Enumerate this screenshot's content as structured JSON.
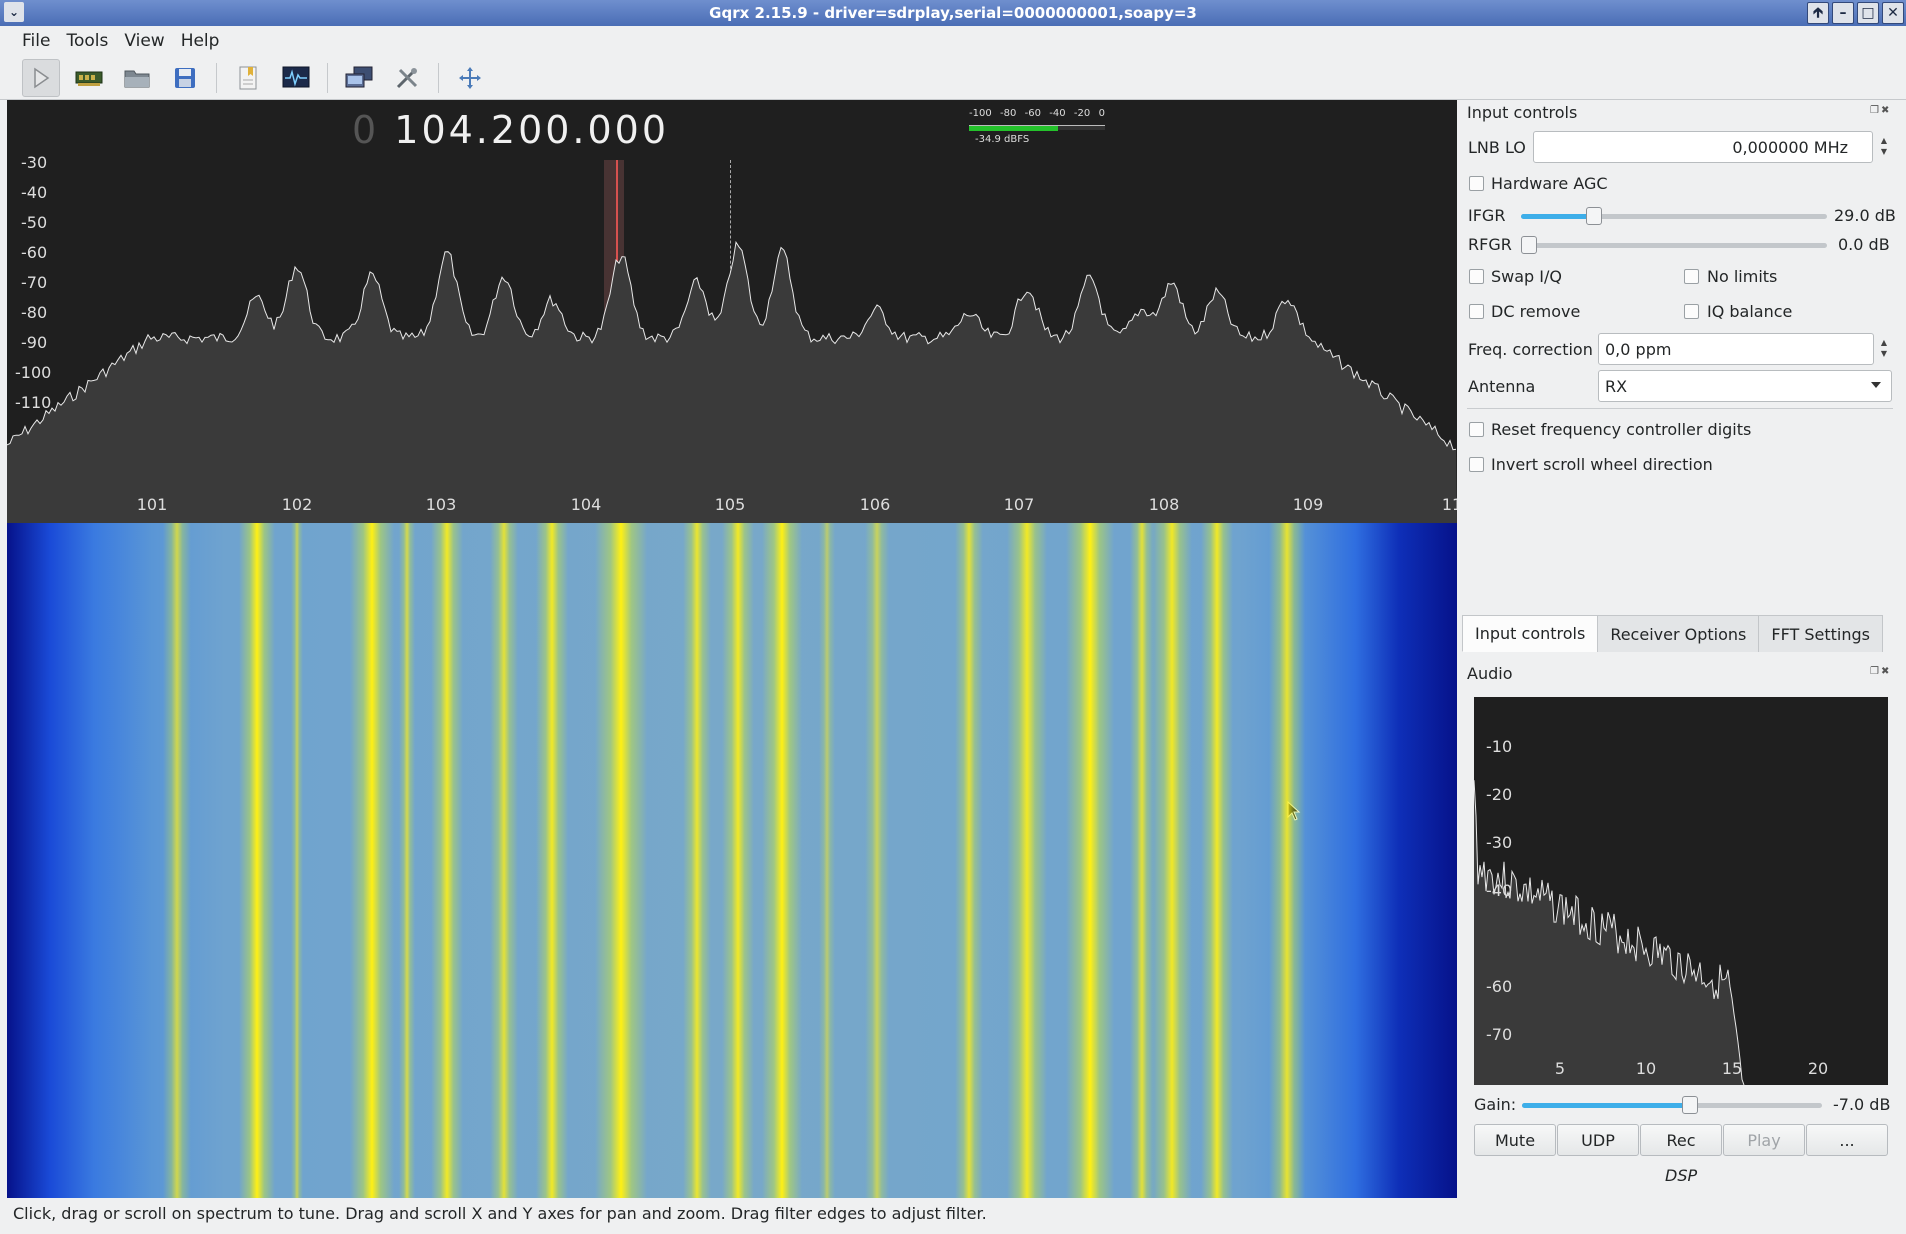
{
  "window": {
    "title": "Gqrx 2.15.9 - driver=sdrplay,serial=0000000001,soapy=3",
    "menu_icon": "chevron-down-icon",
    "buttons": [
      "pin-icon",
      "minimize-icon",
      "maximize-icon",
      "close-icon"
    ]
  },
  "menubar": {
    "items": [
      {
        "label": "File",
        "mnemonic": "F"
      },
      {
        "label": "Tools",
        "mnemonic": "T"
      },
      {
        "label": "View",
        "mnemonic": "V"
      },
      {
        "label": "Help",
        "mnemonic": "H"
      }
    ]
  },
  "toolbar": {
    "items": [
      "play-icon",
      "hardware-icon",
      "open-folder-icon",
      "save-icon",
      "bookmark-icon",
      "io-config-icon",
      "remote-control-icon",
      "tools-icon",
      "fullscreen-icon"
    ]
  },
  "spectrum": {
    "freq_prefix": "0",
    "freq": "104.200.000",
    "smeter_ticks": [
      "-100",
      "-80",
      "-60",
      "-40",
      "-20",
      "0"
    ],
    "smeter_level_dbfs": -34.9,
    "smeter_text": "-34.9 dBFS",
    "db_ticks": [
      "-30",
      "-40",
      "-50",
      "-60",
      "-70",
      "-80",
      "-90",
      "-100",
      "-110"
    ],
    "freq_ticks": [
      "101",
      "102",
      "103",
      "104",
      "105",
      "106",
      "107",
      "108",
      "109",
      "11"
    ]
  },
  "input_controls": {
    "title": "Input controls",
    "lnb_lo_label": "LNB LO",
    "lnb_lo_value": "0,000000 MHz",
    "hardware_agc": "Hardware AGC",
    "ifgr_label": "IFGR",
    "ifgr_value": "29.0 dB",
    "ifgr_level": 0.24,
    "rfgr_label": "RFGR",
    "rfgr_value": "0.0 dB",
    "rfgr_level": 0.0,
    "swap_iq": "Swap I/Q",
    "no_limits": "No limits",
    "dc_remove": "DC remove",
    "iq_balance": "IQ balance",
    "freq_corr_label": "Freq. correction",
    "freq_corr_value": "0,0 ppm",
    "antenna_label": "Antenna",
    "antenna_value": "RX",
    "reset_freq": "Reset frequency controller digits",
    "invert_scroll": "Invert scroll wheel direction"
  },
  "tabs": [
    "Input controls",
    "Receiver Options",
    "FFT Settings"
  ],
  "audio": {
    "title": "Audio",
    "y_ticks": [
      "-10",
      "-20",
      "-30",
      "-40",
      "-60",
      "-70"
    ],
    "x_ticks": [
      "5",
      "10",
      "15",
      "20"
    ],
    "gain_label": "Gain:",
    "gain_value": "-7.0 dB",
    "gain_level": 0.56,
    "buttons": [
      "Mute",
      "UDP",
      "Rec",
      "Play",
      "..."
    ],
    "dsp_label": "DSP"
  },
  "status": {
    "text": "Click, drag or scroll on spectrum to tune. Drag and scroll X and Y axes for pan and zoom. Drag filter edges to adjust filter."
  }
}
